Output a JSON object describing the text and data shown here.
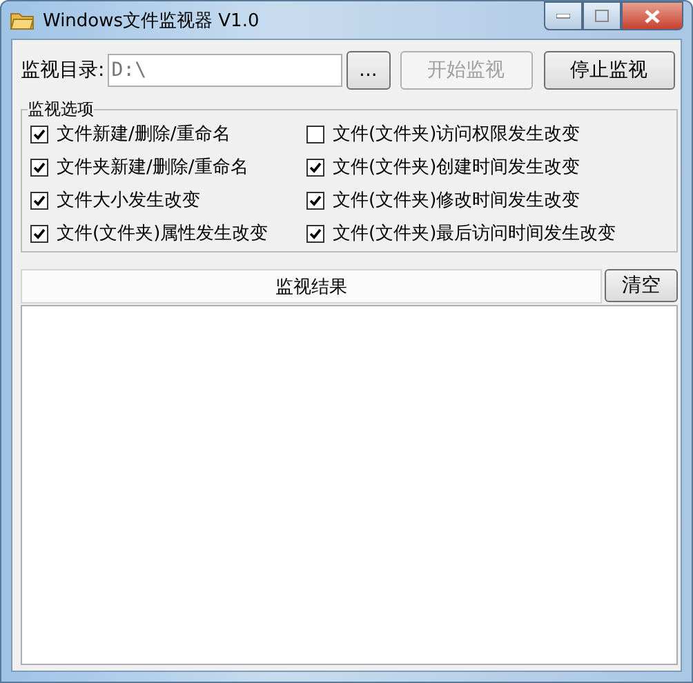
{
  "window": {
    "title": "Windows文件监视器 V1.0"
  },
  "directory": {
    "label": "监视目录:",
    "value": "D:\\",
    "browse": "...",
    "start": {
      "label": "开始监视",
      "disabled": true
    },
    "stop": {
      "label": "停止监视",
      "disabled": false
    }
  },
  "options": {
    "title": "监视选项",
    "items": [
      {
        "label": "文件新建/删除/重命名",
        "checked": true
      },
      {
        "label": "文件(文件夹)访问权限发生改变",
        "checked": false
      },
      {
        "label": "文件夹新建/删除/重命名",
        "checked": true
      },
      {
        "label": "文件(文件夹)创建时间发生改变",
        "checked": true
      },
      {
        "label": "文件大小发生改变",
        "checked": true
      },
      {
        "label": "文件(文件夹)修改时间发生改变",
        "checked": true
      },
      {
        "label": "文件(文件夹)属性发生改变",
        "checked": true
      },
      {
        "label": "文件(文件夹)最后访问时间发生改变",
        "checked": true
      }
    ]
  },
  "results": {
    "header": "监视结果",
    "clear": "清空"
  }
}
